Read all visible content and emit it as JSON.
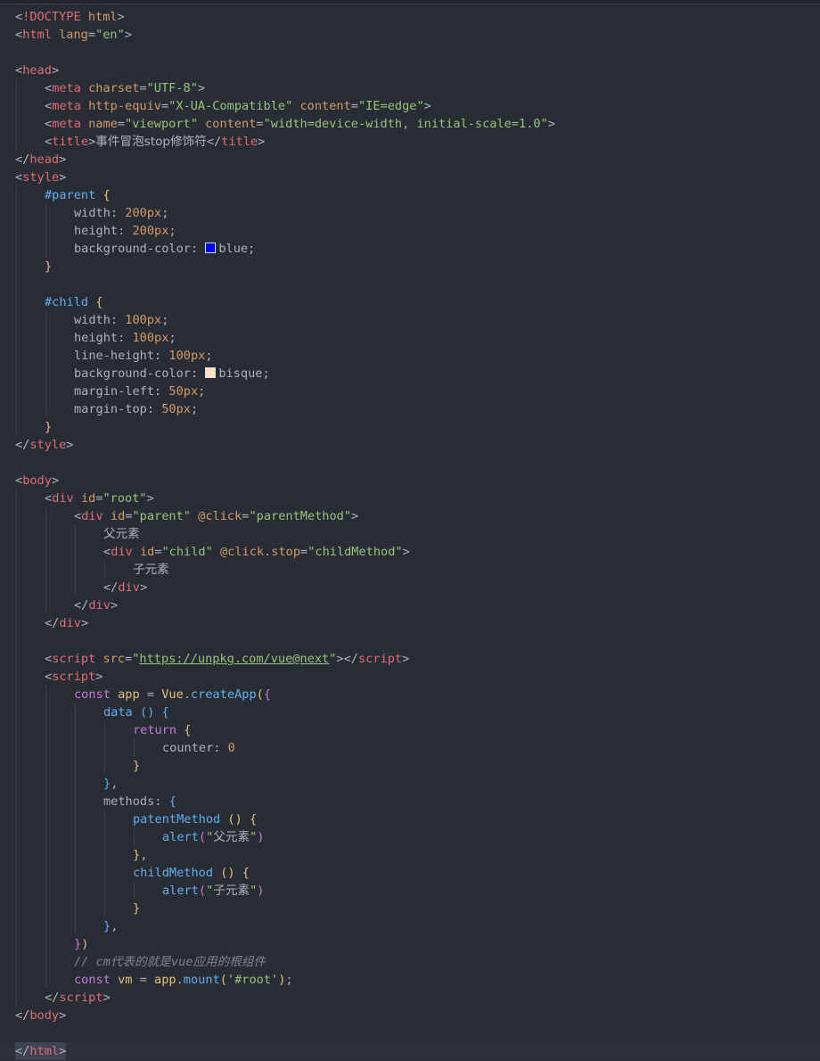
{
  "editor": {
    "colors": {
      "background": "#282c34",
      "tag": "#e06c75",
      "string": "#98c379",
      "keyword": "#c678dd",
      "function": "#61afef",
      "number": "#d19a66"
    },
    "swatches": {
      "blue": "#0000ff",
      "bisque": "#ffe4c4"
    },
    "lines": [
      {
        "indent": 0,
        "tokens": [
          [
            "punct",
            "<"
          ],
          [
            "tag",
            "!DOCTYPE"
          ],
          [
            "punct",
            " "
          ],
          [
            "attr",
            "html"
          ],
          [
            "punct",
            ">"
          ]
        ]
      },
      {
        "indent": 0,
        "tokens": [
          [
            "punct",
            "<"
          ],
          [
            "tag",
            "html"
          ],
          [
            "punct",
            " "
          ],
          [
            "attr",
            "lang"
          ],
          [
            "punct",
            "="
          ],
          [
            "str",
            "\"en\""
          ],
          [
            "punct",
            ">"
          ]
        ]
      },
      {
        "indent": 0,
        "tokens": []
      },
      {
        "indent": 0,
        "tokens": [
          [
            "punct",
            "<"
          ],
          [
            "tag",
            "head"
          ],
          [
            "punct",
            ">"
          ]
        ]
      },
      {
        "indent": 1,
        "tokens": [
          [
            "punct",
            "<"
          ],
          [
            "tag",
            "meta"
          ],
          [
            "punct",
            " "
          ],
          [
            "attr",
            "charset"
          ],
          [
            "punct",
            "="
          ],
          [
            "str",
            "\"UTF-8\""
          ],
          [
            "punct",
            ">"
          ]
        ]
      },
      {
        "indent": 1,
        "tokens": [
          [
            "punct",
            "<"
          ],
          [
            "tag",
            "meta"
          ],
          [
            "punct",
            " "
          ],
          [
            "attr",
            "http-equiv"
          ],
          [
            "punct",
            "="
          ],
          [
            "str",
            "\"X-UA-Compatible\""
          ],
          [
            "punct",
            " "
          ],
          [
            "attr",
            "content"
          ],
          [
            "punct",
            "="
          ],
          [
            "str",
            "\"IE=edge\""
          ],
          [
            "punct",
            ">"
          ]
        ]
      },
      {
        "indent": 1,
        "tokens": [
          [
            "punct",
            "<"
          ],
          [
            "tag",
            "meta"
          ],
          [
            "punct",
            " "
          ],
          [
            "attr",
            "name"
          ],
          [
            "punct",
            "="
          ],
          [
            "str",
            "\"viewport\""
          ],
          [
            "punct",
            " "
          ],
          [
            "attr",
            "content"
          ],
          [
            "punct",
            "="
          ],
          [
            "str",
            "\"width=device-width, initial-scale=1.0\""
          ],
          [
            "punct",
            ">"
          ]
        ]
      },
      {
        "indent": 1,
        "tokens": [
          [
            "punct",
            "<"
          ],
          [
            "tag",
            "title"
          ],
          [
            "punct",
            ">"
          ],
          [
            "cjk",
            "事件冒泡stop修饰符"
          ],
          [
            "punct",
            "</"
          ],
          [
            "tag",
            "title"
          ],
          [
            "punct",
            ">"
          ]
        ]
      },
      {
        "indent": 0,
        "tokens": [
          [
            "punct",
            "</"
          ],
          [
            "tag",
            "head"
          ],
          [
            "punct",
            ">"
          ]
        ]
      },
      {
        "indent": 0,
        "tokens": [
          [
            "punct",
            "<"
          ],
          [
            "tag",
            "style"
          ],
          [
            "punct",
            ">"
          ]
        ]
      },
      {
        "indent": 1,
        "tokens": [
          [
            "sel",
            "#parent"
          ],
          [
            "punct",
            " "
          ],
          [
            "br1",
            "{"
          ]
        ]
      },
      {
        "indent": 2,
        "tokens": [
          [
            "prop",
            "width"
          ],
          [
            "punct",
            ": "
          ],
          [
            "num",
            "200px"
          ],
          [
            "punct",
            ";"
          ]
        ]
      },
      {
        "indent": 2,
        "tokens": [
          [
            "prop",
            "height"
          ],
          [
            "punct",
            ": "
          ],
          [
            "num",
            "200px"
          ],
          [
            "punct",
            ";"
          ]
        ]
      },
      {
        "indent": 2,
        "tokens": [
          [
            "prop",
            "background-color"
          ],
          [
            "punct",
            ": "
          ],
          [
            "swatch",
            "blue"
          ],
          [
            "prop",
            "blue"
          ],
          [
            "punct",
            ";"
          ]
        ]
      },
      {
        "indent": 1,
        "tokens": [
          [
            "br1",
            "}"
          ]
        ]
      },
      {
        "indent": 1,
        "tokens": []
      },
      {
        "indent": 1,
        "tokens": [
          [
            "sel",
            "#child"
          ],
          [
            "punct",
            " "
          ],
          [
            "br1",
            "{"
          ]
        ]
      },
      {
        "indent": 2,
        "tokens": [
          [
            "prop",
            "width"
          ],
          [
            "punct",
            ": "
          ],
          [
            "num",
            "100px"
          ],
          [
            "punct",
            ";"
          ]
        ]
      },
      {
        "indent": 2,
        "tokens": [
          [
            "prop",
            "height"
          ],
          [
            "punct",
            ": "
          ],
          [
            "num",
            "100px"
          ],
          [
            "punct",
            ";"
          ]
        ]
      },
      {
        "indent": 2,
        "tokens": [
          [
            "prop",
            "line-height"
          ],
          [
            "punct",
            ": "
          ],
          [
            "num",
            "100px"
          ],
          [
            "punct",
            ";"
          ]
        ]
      },
      {
        "indent": 2,
        "tokens": [
          [
            "prop",
            "background-color"
          ],
          [
            "punct",
            ": "
          ],
          [
            "swatch",
            "bisque"
          ],
          [
            "prop",
            "bisque"
          ],
          [
            "punct",
            ";"
          ]
        ]
      },
      {
        "indent": 2,
        "tokens": [
          [
            "prop",
            "margin-left"
          ],
          [
            "punct",
            ": "
          ],
          [
            "num",
            "50px"
          ],
          [
            "punct",
            ";"
          ]
        ]
      },
      {
        "indent": 2,
        "tokens": [
          [
            "prop",
            "margin-top"
          ],
          [
            "punct",
            ": "
          ],
          [
            "num",
            "50px"
          ],
          [
            "punct",
            ";"
          ]
        ]
      },
      {
        "indent": 1,
        "tokens": [
          [
            "br1",
            "}"
          ]
        ]
      },
      {
        "indent": 0,
        "tokens": [
          [
            "punct",
            "</"
          ],
          [
            "tag",
            "style"
          ],
          [
            "punct",
            ">"
          ]
        ]
      },
      {
        "indent": 0,
        "tokens": []
      },
      {
        "indent": 0,
        "tokens": [
          [
            "punct",
            "<"
          ],
          [
            "tag",
            "body"
          ],
          [
            "punct",
            ">"
          ]
        ]
      },
      {
        "indent": 1,
        "tokens": [
          [
            "punct",
            "<"
          ],
          [
            "tag",
            "div"
          ],
          [
            "punct",
            " "
          ],
          [
            "attr",
            "id"
          ],
          [
            "punct",
            "="
          ],
          [
            "str",
            "\"root\""
          ],
          [
            "punct",
            ">"
          ]
        ]
      },
      {
        "indent": 2,
        "tokens": [
          [
            "punct",
            "<"
          ],
          [
            "tag",
            "div"
          ],
          [
            "punct",
            " "
          ],
          [
            "attr",
            "id"
          ],
          [
            "punct",
            "="
          ],
          [
            "str",
            "\"parent\""
          ],
          [
            "punct",
            " "
          ],
          [
            "attr",
            "@click"
          ],
          [
            "punct",
            "="
          ],
          [
            "str",
            "\"parentMethod\""
          ],
          [
            "punct",
            ">"
          ]
        ]
      },
      {
        "indent": 3,
        "tokens": [
          [
            "cjk",
            "父元素"
          ]
        ]
      },
      {
        "indent": 3,
        "tokens": [
          [
            "punct",
            "<"
          ],
          [
            "tag",
            "div"
          ],
          [
            "punct",
            " "
          ],
          [
            "attr",
            "id"
          ],
          [
            "punct",
            "="
          ],
          [
            "str",
            "\"child\""
          ],
          [
            "punct",
            " "
          ],
          [
            "attr",
            "@click.stop"
          ],
          [
            "punct",
            "="
          ],
          [
            "str",
            "\"childMethod\""
          ],
          [
            "punct",
            ">"
          ]
        ]
      },
      {
        "indent": 4,
        "tokens": [
          [
            "cjk",
            "子元素"
          ]
        ]
      },
      {
        "indent": 3,
        "tokens": [
          [
            "punct",
            "</"
          ],
          [
            "tag",
            "div"
          ],
          [
            "punct",
            ">"
          ]
        ]
      },
      {
        "indent": 2,
        "tokens": [
          [
            "punct",
            "</"
          ],
          [
            "tag",
            "div"
          ],
          [
            "punct",
            ">"
          ]
        ]
      },
      {
        "indent": 1,
        "tokens": [
          [
            "punct",
            "</"
          ],
          [
            "tag",
            "div"
          ],
          [
            "punct",
            ">"
          ]
        ]
      },
      {
        "indent": 1,
        "tokens": []
      },
      {
        "indent": 1,
        "tokens": [
          [
            "punct",
            "<"
          ],
          [
            "tag",
            "script"
          ],
          [
            "punct",
            " "
          ],
          [
            "attr",
            "src"
          ],
          [
            "punct",
            "="
          ],
          [
            "str",
            "\""
          ],
          [
            "link",
            "https://unpkg.com/vue@next"
          ],
          [
            "str",
            "\""
          ],
          [
            "punct",
            "></"
          ],
          [
            "tag",
            "script"
          ],
          [
            "punct",
            ">"
          ]
        ]
      },
      {
        "indent": 1,
        "tokens": [
          [
            "punct",
            "<"
          ],
          [
            "tag",
            "script"
          ],
          [
            "punct",
            ">"
          ]
        ]
      },
      {
        "indent": 2,
        "tokens": [
          [
            "kw",
            "const"
          ],
          [
            "punct",
            " "
          ],
          [
            "var",
            "app"
          ],
          [
            "punct",
            " = "
          ],
          [
            "var",
            "Vue"
          ],
          [
            "punct",
            "."
          ],
          [
            "fn",
            "createApp"
          ],
          [
            "br1",
            "("
          ],
          [
            "br2",
            "{"
          ]
        ]
      },
      {
        "indent": 3,
        "tokens": [
          [
            "fn",
            "data"
          ],
          [
            "punct",
            " "
          ],
          [
            "br3",
            "()"
          ],
          [
            "punct",
            " "
          ],
          [
            "br3",
            "{"
          ]
        ]
      },
      {
        "indent": 4,
        "tokens": [
          [
            "kw",
            "return"
          ],
          [
            "punct",
            " "
          ],
          [
            "br1",
            "{"
          ]
        ]
      },
      {
        "indent": 5,
        "tokens": [
          [
            "prop",
            "counter"
          ],
          [
            "punct",
            ": "
          ],
          [
            "num",
            "0"
          ]
        ]
      },
      {
        "indent": 4,
        "tokens": [
          [
            "br1",
            "}"
          ]
        ]
      },
      {
        "indent": 3,
        "tokens": [
          [
            "br3",
            "}"
          ],
          [
            "punct",
            ","
          ]
        ]
      },
      {
        "indent": 3,
        "tokens": [
          [
            "prop",
            "methods"
          ],
          [
            "punct",
            ": "
          ],
          [
            "br3",
            "{"
          ]
        ]
      },
      {
        "indent": 4,
        "tokens": [
          [
            "fn",
            "patentMethod"
          ],
          [
            "punct",
            " "
          ],
          [
            "br1",
            "()"
          ],
          [
            "punct",
            " "
          ],
          [
            "br1",
            "{"
          ]
        ]
      },
      {
        "indent": 5,
        "tokens": [
          [
            "fn",
            "alert"
          ],
          [
            "br2",
            "("
          ],
          [
            "str",
            "\""
          ],
          [
            "cjk",
            "父元素"
          ],
          [
            "str",
            "\""
          ],
          [
            "br2",
            ")"
          ]
        ]
      },
      {
        "indent": 4,
        "tokens": [
          [
            "br1",
            "}"
          ],
          [
            "punct",
            ","
          ]
        ]
      },
      {
        "indent": 4,
        "tokens": [
          [
            "fn",
            "childMethod"
          ],
          [
            "punct",
            " "
          ],
          [
            "br1",
            "()"
          ],
          [
            "punct",
            " "
          ],
          [
            "br1",
            "{"
          ]
        ]
      },
      {
        "indent": 5,
        "tokens": [
          [
            "fn",
            "alert"
          ],
          [
            "br2",
            "("
          ],
          [
            "str",
            "\""
          ],
          [
            "cjk",
            "子元素"
          ],
          [
            "str",
            "\""
          ],
          [
            "br2",
            ")"
          ]
        ]
      },
      {
        "indent": 4,
        "tokens": [
          [
            "br1",
            "}"
          ]
        ]
      },
      {
        "indent": 3,
        "tokens": [
          [
            "br3",
            "}"
          ],
          [
            "punct",
            ","
          ]
        ]
      },
      {
        "indent": 2,
        "tokens": [
          [
            "br2",
            "}"
          ],
          [
            "br1",
            ")"
          ]
        ]
      },
      {
        "indent": 2,
        "tokens": [
          [
            "com",
            "// cm代表的就是vue应用的根组件"
          ]
        ]
      },
      {
        "indent": 2,
        "tokens": [
          [
            "kw",
            "const"
          ],
          [
            "punct",
            " "
          ],
          [
            "var",
            "vm"
          ],
          [
            "punct",
            " = "
          ],
          [
            "var",
            "app"
          ],
          [
            "punct",
            "."
          ],
          [
            "fn",
            "mount"
          ],
          [
            "br1",
            "("
          ],
          [
            "str",
            "'#root'"
          ],
          [
            "br1",
            ")"
          ],
          [
            "punct",
            ";"
          ]
        ]
      },
      {
        "indent": 1,
        "tokens": [
          [
            "punct",
            "</"
          ],
          [
            "tag",
            "script"
          ],
          [
            "punct",
            ">"
          ]
        ]
      },
      {
        "indent": 0,
        "tokens": [
          [
            "punct",
            "</"
          ],
          [
            "tag",
            "body"
          ],
          [
            "punct",
            ">"
          ]
        ]
      },
      {
        "indent": 0,
        "tokens": []
      },
      {
        "indent": 0,
        "current": true,
        "tokens": [
          [
            "punct",
            "</"
          ],
          [
            "tag",
            "html"
          ],
          [
            "punct",
            ">"
          ]
        ]
      }
    ]
  }
}
